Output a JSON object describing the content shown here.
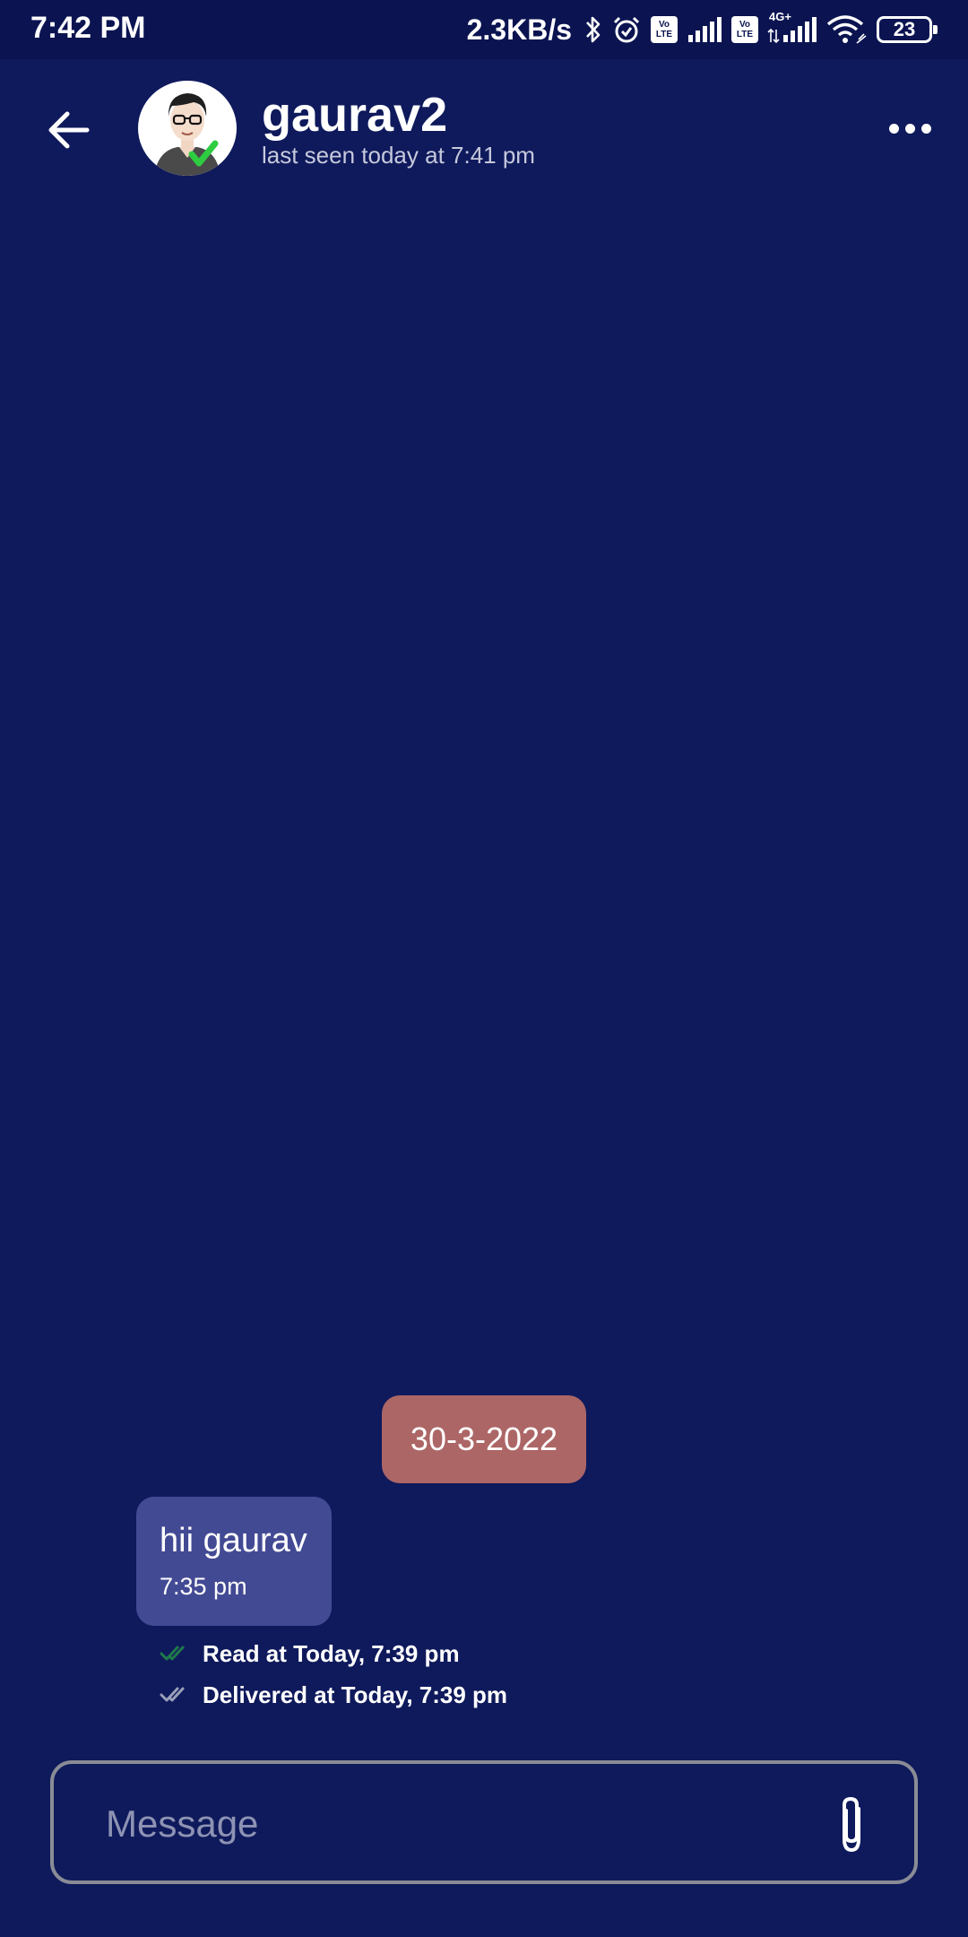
{
  "status_bar": {
    "time": "7:42 PM",
    "net_speed": "2.3KB/s",
    "icons": [
      "bluetooth-icon",
      "alarm-icon",
      "volte-icon",
      "signal-icon",
      "volte-icon",
      "signal-4g-icon",
      "wifi-icon",
      "battery-icon"
    ],
    "volte_label_top": "Vo",
    "volte_label_bottom": "LTE",
    "network_type": "4G+",
    "battery_level": "23"
  },
  "header": {
    "back_icon": "arrow-left-icon",
    "contact_name": "gaurav2",
    "last_seen": "last seen today at 7:41 pm",
    "more_icon": "more-horizontal-icon"
  },
  "chat": {
    "date_separator": "30-3-2022",
    "messages": [
      {
        "text": "hii gaurav",
        "time": "7:35 pm"
      }
    ],
    "receipts": {
      "read": "Read at Today, 7:39 pm",
      "delivered": "Delivered at Today, 7:39 pm"
    }
  },
  "composer": {
    "placeholder": "Message",
    "value": "",
    "attach_icon": "paperclip-icon"
  },
  "colors": {
    "background": "#0f1a5c",
    "status_bar": "#0b1451",
    "date_chip": "#ad6666",
    "bubble": "#434a94",
    "read_check": "#1f7a4a",
    "delivered_check": "#9aa0b8"
  }
}
